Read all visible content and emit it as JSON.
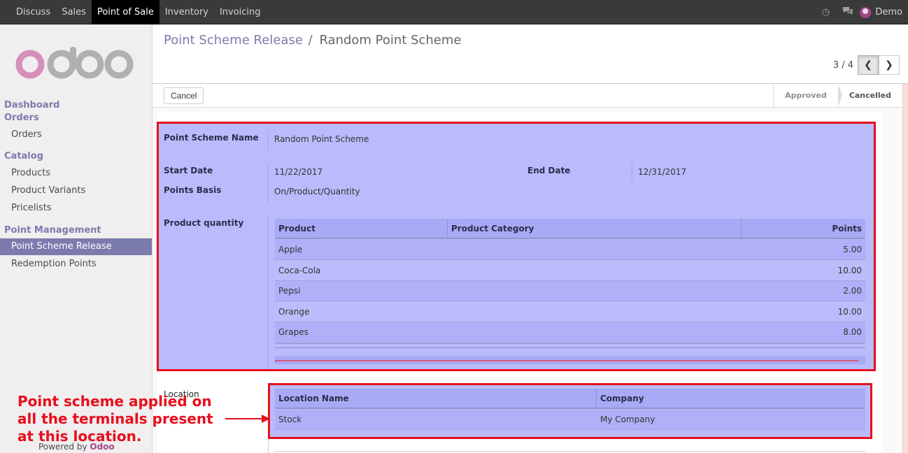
{
  "topbar": {
    "menu": [
      "Discuss",
      "Sales",
      "Point of Sale",
      "Inventory",
      "Invoicing"
    ],
    "active": "Point of Sale",
    "user": "Demo"
  },
  "sidebar": {
    "logo_text": "odoo",
    "sections": [
      {
        "heading": "Dashboard"
      },
      {
        "heading": "Orders",
        "items": [
          "Orders"
        ]
      },
      {
        "heading": "Catalog",
        "items": [
          "Products",
          "Product Variants",
          "Pricelists"
        ]
      },
      {
        "heading": "Point Management",
        "items": [
          "Point Scheme Release",
          "Redemption Points"
        ]
      }
    ],
    "active_item": "Point Scheme Release",
    "powered_prefix": "Powered by",
    "powered_brand": "Odoo"
  },
  "breadcrumb": {
    "parent": "Point Scheme Release",
    "separator": "/",
    "current": "Random Point Scheme"
  },
  "pager": {
    "counter": "3 / 4"
  },
  "statusbar": {
    "cancel_label": "Cancel",
    "stages": [
      "Approved",
      "Cancelled"
    ],
    "current_stage": "Cancelled"
  },
  "form": {
    "name_label": "Point Scheme Name",
    "name_value": "Random Point Scheme",
    "start_label": "Start Date",
    "start_value": "11/22/2017",
    "end_label": "End Date",
    "end_value": "12/31/2017",
    "basis_label": "Points Basis",
    "basis_value": "On/Product/Quantity",
    "quantity_label": "Product quantity",
    "product_table": {
      "headers": [
        "Product",
        "Product Category",
        "Points"
      ],
      "rows": [
        {
          "product": "Apple",
          "category": "",
          "points": "5.00"
        },
        {
          "product": "Coca-Cola",
          "category": "",
          "points": "10.00"
        },
        {
          "product": "Pepsi",
          "category": "",
          "points": "2.00"
        },
        {
          "product": "Orange",
          "category": "",
          "points": "10.00"
        },
        {
          "product": "Grapes",
          "category": "",
          "points": "8.00"
        }
      ]
    },
    "location_label": "Location",
    "location_table": {
      "headers": [
        "Location Name",
        "Company"
      ],
      "rows": [
        {
          "location": "Stock",
          "company": "My Company"
        }
      ]
    }
  },
  "annotation": {
    "lines": [
      "Point scheme applied on",
      "all the terminals present",
      "at this location."
    ]
  },
  "colors": {
    "brand": "#7c7bad",
    "highlight_border": "#e80e1c",
    "highlight_fill": "#babbfc"
  }
}
